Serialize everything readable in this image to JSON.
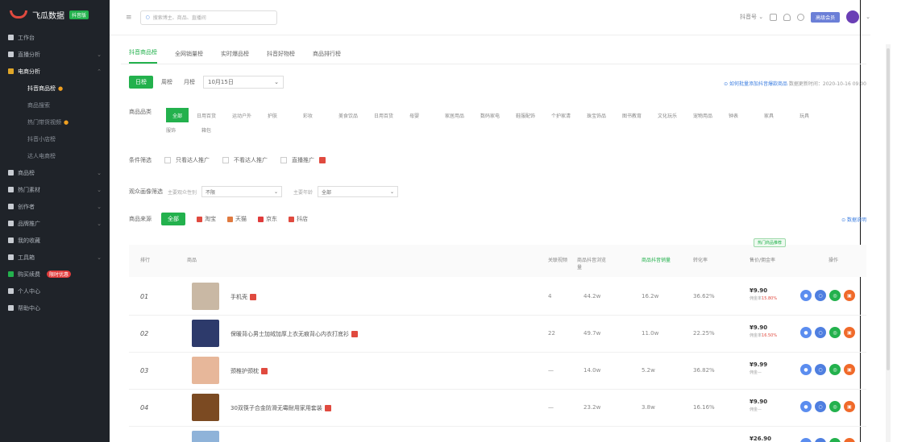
{
  "colors": {
    "accent": "#23b14d",
    "sidebar": "#1f2329",
    "danger": "#e04a3f"
  },
  "logo": {
    "text": "飞瓜数据",
    "badge": "抖音版"
  },
  "sidebar": {
    "items": [
      {
        "label": "工作台",
        "icon": "home-icon"
      },
      {
        "label": "直播分析",
        "icon": "chart-icon"
      },
      {
        "label": "电商分析",
        "icon": "shop-icon",
        "expanded": true
      },
      {
        "label": "商品榜",
        "icon": "goods-icon"
      },
      {
        "label": "热门素材",
        "icon": "fire-icon"
      },
      {
        "label": "创作者",
        "icon": "user-icon"
      },
      {
        "label": "品牌推广",
        "icon": "heart-icon"
      },
      {
        "label": "我的收藏",
        "icon": "star-icon"
      },
      {
        "label": "工具箱",
        "icon": "tool-icon"
      },
      {
        "label": "购买续费",
        "icon": "cart-icon",
        "badge": "限时优惠"
      },
      {
        "label": "个人中心",
        "icon": "person-icon"
      },
      {
        "label": "帮助中心",
        "icon": "help-icon"
      }
    ],
    "sub_items": [
      {
        "label": "抖音商品榜",
        "hot": true,
        "current": true
      },
      {
        "label": "商品搜索",
        "hot": false
      },
      {
        "label": "热门带货视频",
        "hot": true
      },
      {
        "label": "抖音小店榜",
        "hot": false
      },
      {
        "label": "达人电商榜",
        "hot": false
      }
    ]
  },
  "topbar": {
    "search_placeholder": "搜索博主、商品、直播间",
    "right_label": "抖音号",
    "member_label": "高级会员"
  },
  "tabs": [
    "抖音商品榜",
    "全网销量榜",
    "实时爆品榜",
    "抖音好物榜",
    "商品排行榜"
  ],
  "period": {
    "buttons": [
      "日榜",
      "周榜",
      "月榜"
    ],
    "date": "10月15日"
  },
  "note": {
    "link": "⊙ 如何批量添加抖音爆款商品",
    "time": "数据更新时间：2020-10-16 09:00"
  },
  "category": {
    "label": "商品品类",
    "items": [
      "全部",
      "日用百货",
      "运动户外",
      "护肤",
      "彩妆",
      "美食饮品",
      "日用百货",
      "母婴",
      "家居用品",
      "数码家电",
      "鞋服配饰",
      "个护家清",
      "珠宝饰品",
      "图书教育",
      "文化玩乐",
      "宠物用品",
      "钟表",
      "家具",
      "玩具",
      "服饰",
      "箱包"
    ]
  },
  "filter": {
    "label": "条件筛选",
    "options": [
      "只看达人推广",
      "不看达人推广",
      "直播推广"
    ]
  },
  "audience": {
    "label": "观众画像筛选",
    "gender_label": "主要观众性别",
    "gender_value": "不限",
    "age_label": "主要年龄",
    "age_value": "全部"
  },
  "source": {
    "label": "商品来源",
    "options": [
      {
        "label": "全部",
        "color": "#23b14d"
      },
      {
        "label": "淘宝",
        "color": "#e04a3f"
      },
      {
        "label": "天猫",
        "color": "#e04a3f"
      },
      {
        "label": "京东",
        "color": "#e03b3b"
      },
      {
        "label": "抖店",
        "color": "#e04a3f"
      }
    ],
    "right_link": "⊙ 数据说明"
  },
  "table": {
    "headers": {
      "rank": "排行",
      "product": "商品",
      "live": "关联视频",
      "views": "商品抖音浏览量",
      "sales": "商品抖音销量",
      "conv": "转化率",
      "price": "售价/佣金率",
      "action": "操作"
    },
    "tooltip": "热门商品推荐",
    "rows": [
      {
        "rank": "01",
        "name": "手机壳",
        "live": "4",
        "views": "44.2w",
        "sales": "16.2w",
        "conv": "36.62%",
        "price": "¥9.90",
        "commission": "佣金率",
        "commission_val": "15.80%",
        "img": "#c9b8a4"
      },
      {
        "rank": "02",
        "name": "保暖背心男士加绒加厚上衣无痕背心内衣打底衫",
        "live": "22",
        "views": "49.7w",
        "sales": "11.0w",
        "conv": "22.25%",
        "price": "¥9.90",
        "commission": "佣金率",
        "commission_val": "16.50%",
        "img": "#2d3a6b"
      },
      {
        "rank": "03",
        "name": "颈椎护颈枕",
        "live": "—",
        "views": "14.0w",
        "sales": "5.2w",
        "conv": "36.82%",
        "price": "¥9.99",
        "commission": "佣金—",
        "commission_val": "",
        "img": "#e7b79a"
      },
      {
        "rank": "04",
        "name": "30双筷子合金防滑无霉耐用家用套装",
        "live": "—",
        "views": "23.2w",
        "sales": "3.8w",
        "conv": "16.16%",
        "price": "¥9.90",
        "commission": "佣金—",
        "commission_val": "",
        "img": "#7b4a22"
      },
      {
        "rank": "05",
        "name": "",
        "live": "",
        "views": "",
        "sales": "",
        "conv": "",
        "price": "¥26.90",
        "commission": "",
        "commission_val": "",
        "img": "#8fb3d9"
      }
    ]
  }
}
